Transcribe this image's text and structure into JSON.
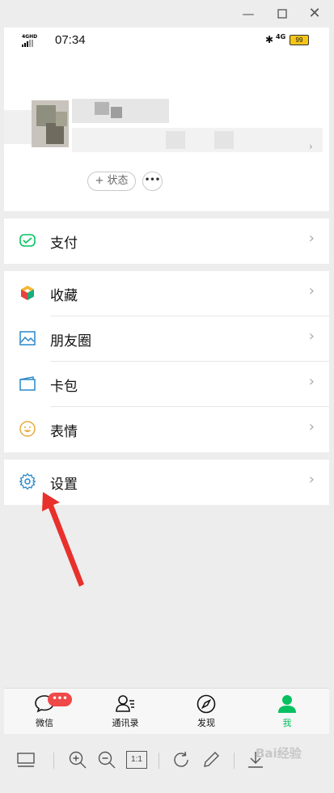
{
  "window": {
    "minimize_icon": "minimize-icon",
    "maximize_icon": "maximize-icon",
    "close_icon": "close-icon"
  },
  "status_bar": {
    "network": "4GHD",
    "time": "07:34",
    "cellular": "4G",
    "battery": "99"
  },
  "profile": {
    "status_button": "+ 状态",
    "more_button": "•••"
  },
  "menu": {
    "pay": "支付",
    "favorites": "收藏",
    "moments": "朋友圈",
    "cards": "卡包",
    "stickers": "表情",
    "settings": "设置"
  },
  "tabs": [
    {
      "label": "微信",
      "badge": "•••"
    },
    {
      "label": "通讯录"
    },
    {
      "label": "发现"
    },
    {
      "label": "我"
    }
  ],
  "toolbar": {
    "actual_size": "1:1"
  },
  "watermark": "Bai经验",
  "colors": {
    "accent_green": "#07c160",
    "badge_red": "#f04848",
    "arrow_red": "#e8302c"
  }
}
